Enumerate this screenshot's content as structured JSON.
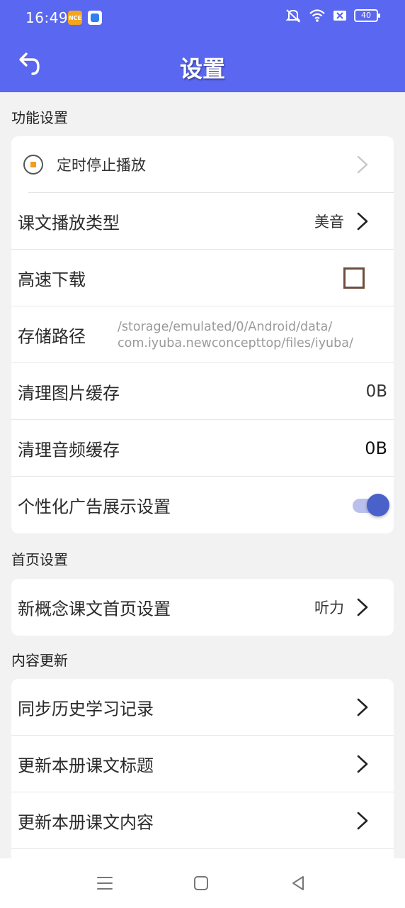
{
  "status_bar": {
    "time": "16:49",
    "app_badge": "NCE",
    "battery": "40",
    "icons": [
      "mute-icon",
      "wifi-icon",
      "sim-icon",
      "battery-icon"
    ]
  },
  "header": {
    "title": "设置",
    "back_icon": "back-arrow-icon"
  },
  "sections": {
    "function": {
      "title": "功能设置",
      "timer": {
        "label": "定时停止播放"
      },
      "play_type": {
        "label": "课文播放类型",
        "value": "美音"
      },
      "fast_download": {
        "label": "高速下载",
        "checked": false
      },
      "storage_path": {
        "label": "存储路径",
        "line1": "/storage/emulated/0/Android/data/",
        "line2": "com.iyuba.newconcepttop/files/iyuba/"
      },
      "image_cache": {
        "label": "清理图片缓存",
        "value": "0B"
      },
      "audio_cache": {
        "label": "清理音频缓存",
        "value": "0B"
      },
      "ads": {
        "label": "个性化广告展示设置",
        "enabled": true
      }
    },
    "home": {
      "title": "首页设置",
      "home_setting": {
        "label": "新概念课文首页设置",
        "value": "听力"
      }
    },
    "content": {
      "title": "内容更新",
      "sync_history": {
        "label": "同步历史学习记录"
      },
      "update_titles": {
        "label": "更新本册课文标题"
      },
      "update_content": {
        "label": "更新本册课文内容"
      }
    }
  },
  "colors": {
    "header_bg": "#5a67f0",
    "toggle_on": "#4a61c9",
    "timer_dot": "#f59c1a",
    "checkbox_border": "#6d4e3e"
  },
  "nav_bar": {
    "icons": [
      "menu-icon",
      "home-icon",
      "back-icon"
    ]
  }
}
